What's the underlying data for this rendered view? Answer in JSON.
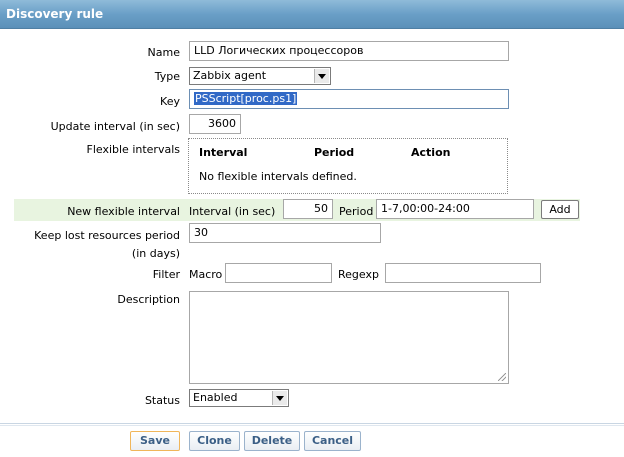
{
  "window": {
    "title": "Discovery rule"
  },
  "form": {
    "name": {
      "label": "Name",
      "value": "LLD Логических процессоров"
    },
    "type": {
      "label": "Type",
      "value": "Zabbix agent"
    },
    "key": {
      "label": "Key",
      "value": "PSScript[proc.ps1]"
    },
    "update_interval": {
      "label": "Update interval (in sec)",
      "value": "3600"
    },
    "flexible_intervals": {
      "label": "Flexible intervals",
      "headers": [
        "Interval",
        "Period",
        "Action"
      ],
      "empty_text": "No flexible intervals defined."
    },
    "new_flexible": {
      "label": "New flexible interval",
      "interval_label": "Interval (in sec)",
      "interval_value": "50",
      "period_label": "Period",
      "period_value": "1-7,00:00-24:00",
      "add_label": "Add"
    },
    "keep_lost": {
      "label_line1": "Keep lost resources period",
      "label_line2": "(in days)",
      "value": "30"
    },
    "filter": {
      "label": "Filter",
      "macro_label": "Macro",
      "macro_value": "",
      "regexp_label": "Regexp",
      "regexp_value": ""
    },
    "description": {
      "label": "Description",
      "value": ""
    },
    "status": {
      "label": "Status",
      "value": "Enabled"
    }
  },
  "buttons": {
    "save": "Save",
    "clone": "Clone",
    "delete": "Delete",
    "cancel": "Cancel"
  },
  "colors": {
    "title_bar": "#6a9fc7",
    "new_row_bg": "#e8f4e0",
    "selection": "#3169c6",
    "button_text": "#3b5f86"
  }
}
